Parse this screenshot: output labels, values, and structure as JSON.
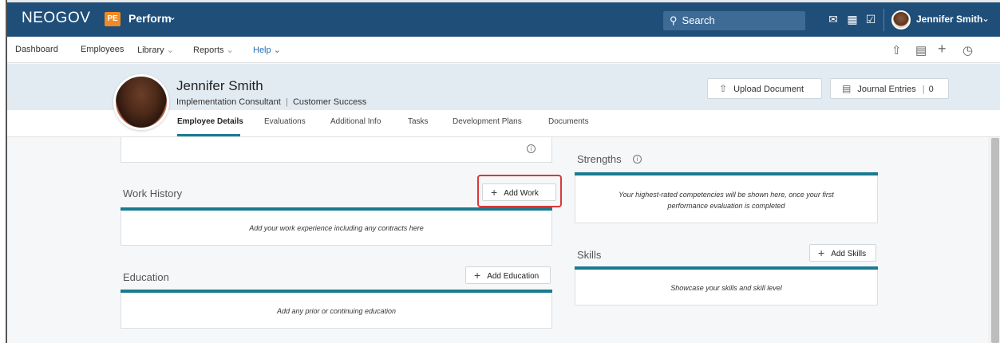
{
  "topbar": {
    "brand": "NEOGOV",
    "product_badge": "PE",
    "product": "Perform",
    "search_placeholder": "Search",
    "user_name": "Jennifer Smith"
  },
  "nav": {
    "items": [
      "Dashboard",
      "Employees",
      "Library",
      "Reports",
      "Help"
    ]
  },
  "profile": {
    "name": "Jennifer Smith",
    "title": "Implementation Consultant",
    "department": "Customer Success",
    "separator": "|",
    "upload_label": "Upload Document",
    "journal_label": "Journal Entries",
    "journal_count": "0"
  },
  "tabs": [
    "Employee Details",
    "Evaluations",
    "Additional Info",
    "Tasks",
    "Development Plans",
    "Documents"
  ],
  "work_history": {
    "title": "Work History",
    "add_label": "Add Work",
    "empty": "Add your work experience including any contracts here"
  },
  "education": {
    "title": "Education",
    "add_label": "Add Education",
    "empty": "Add any prior or continuing education"
  },
  "strengths": {
    "title": "Strengths",
    "empty_line1": "Your highest-rated competencies will be shown here, once your first",
    "empty_line2": "performance evaluation is completed"
  },
  "skills": {
    "title": "Skills",
    "add_label": "Add Skills",
    "empty": "Showcase your skills and skill level"
  },
  "colors": {
    "topbar": "#1f4e79",
    "accent": "#1a7a91",
    "badge": "#f08a24",
    "help_link": "#1e6fb5",
    "highlight": "#d9383a"
  }
}
